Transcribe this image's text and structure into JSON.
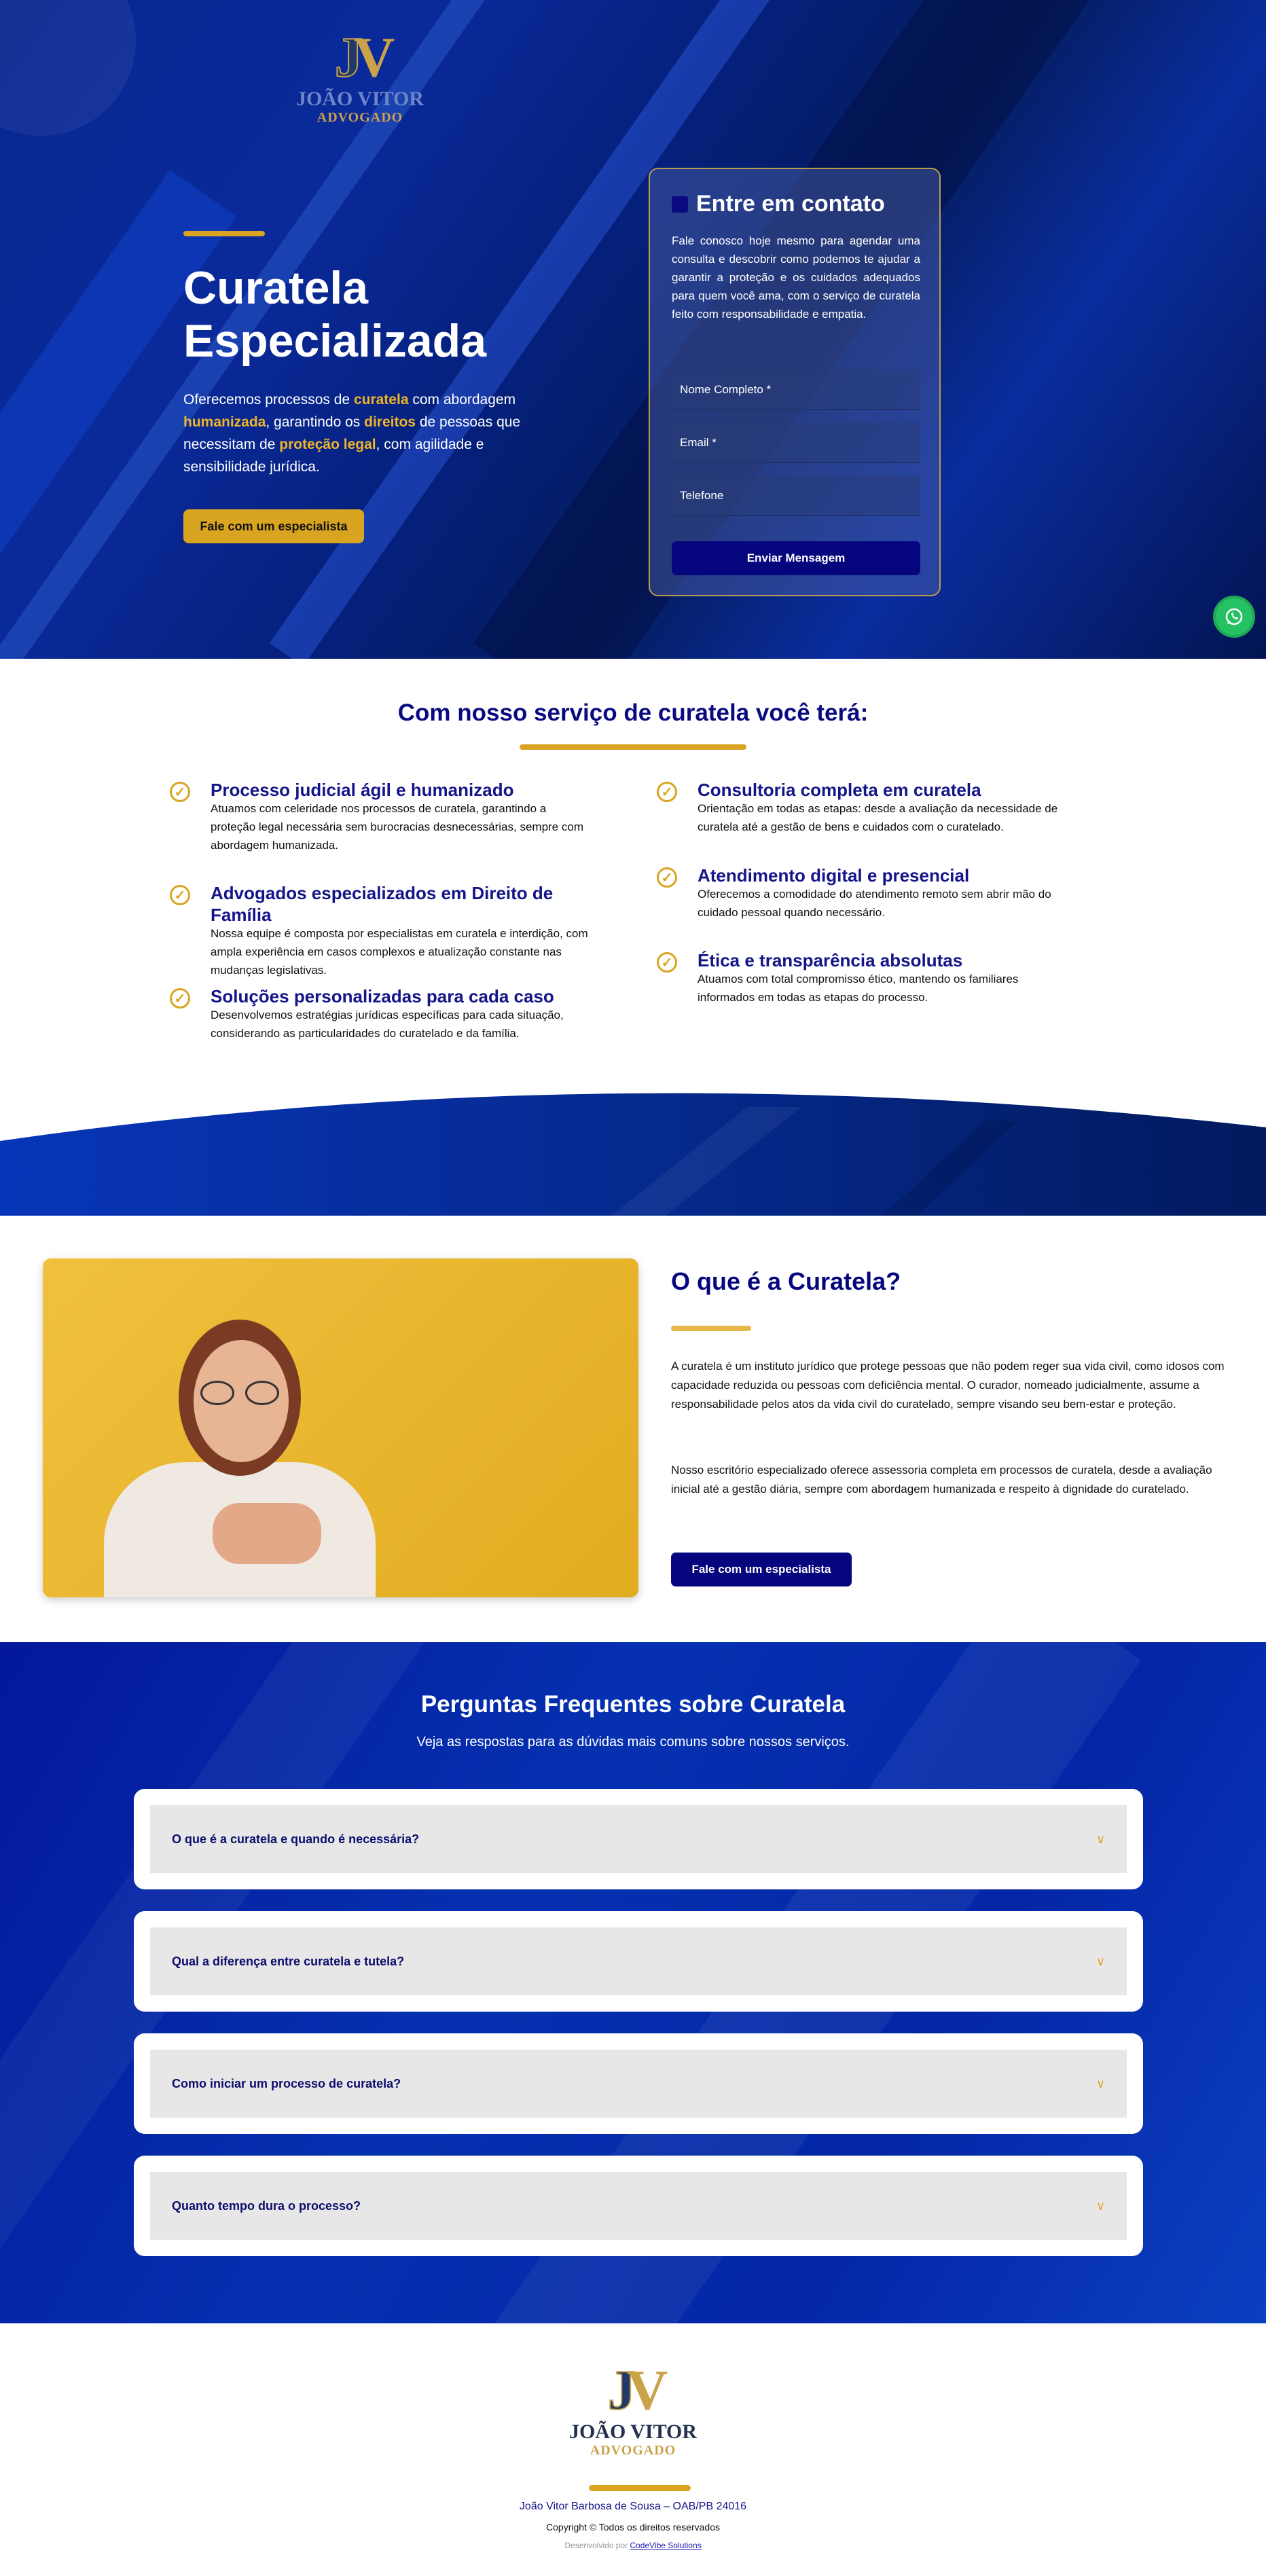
{
  "brand": {
    "logo_monogram": "JV",
    "logo_name": "JOÃO VITOR",
    "logo_sub": "ADVOGADO"
  },
  "hero": {
    "title_line1": "Curatela",
    "title_line2": "Especializada",
    "paragraph": [
      {
        "t": "Oferecemos processos de ",
        "h": false
      },
      {
        "t": "curatela",
        "h": true
      },
      {
        "t": " com abordagem ",
        "h": false
      },
      {
        "t": "humanizada",
        "h": true
      },
      {
        "t": ", garantindo os ",
        "h": false
      },
      {
        "t": "direitos",
        "h": true
      },
      {
        "t": " de pessoas que necessitam de ",
        "h": false
      },
      {
        "t": "proteção legal",
        "h": true
      },
      {
        "t": ", com agilidade e sensibilidade jurídica.",
        "h": false
      }
    ],
    "cta": "Fale com um especialista"
  },
  "contact": {
    "title": "Entre em contato",
    "text": "Fale conosco hoje mesmo para agendar uma consulta e descobrir como podemos te ajudar a garantir a proteção e os cuidados adequados para quem você ama, com o serviço de curatela feito com responsabilidade e empatia.",
    "name_placeholder": "Nome Completo *",
    "email_placeholder": "Email *",
    "phone_placeholder": "Telefone",
    "submit": "Enviar Mensagem"
  },
  "benefits": {
    "title": "Com nosso serviço de curatela você terá:",
    "left": [
      {
        "title": "Processo judicial ágil e humanizado",
        "text": "Atuamos com celeridade nos processos de curatela, garantindo a proteção legal necessária sem burocracias desnecessárias, sempre com abordagem humanizada."
      },
      {
        "title": "Advogados especializados em Direito de Família",
        "text": "Nossa equipe é composta por especialistas em curatela e interdição, com ampla experiência em casos complexos e atualização constante nas mudanças legislativas."
      },
      {
        "title": "Soluções personalizadas para cada caso",
        "text": "Desenvolvemos estratégias jurídicas específicas para cada situação, considerando as particularidades do curatelado e da família."
      }
    ],
    "right": [
      {
        "title": "Consultoria completa em curatela",
        "text": "Orientação em todas as etapas: desde a avaliação da necessidade de curatela até a gestão de bens e cuidados com o curatelado."
      },
      {
        "title": "Atendimento digital e presencial",
        "text": "Oferecemos a comodidade do atendimento remoto sem abrir mão do cuidado pessoal quando necessário."
      },
      {
        "title": "Ética e transparência absolutas",
        "text": "Atuamos com total compromisso ético, mantendo os familiares informados em todas as etapas do processo."
      }
    ]
  },
  "about": {
    "title": "O que é a Curatela?",
    "p1": "A curatela é um instituto jurídico que protege pessoas que não podem reger sua vida civil, como idosos com capacidade reduzida ou pessoas com deficiência mental. O curador, nomeado judicialmente, assume a responsabilidade pelos atos da vida civil do curatelado, sempre visando seu bem-estar e proteção.",
    "p2": "Nosso escritório especializado oferece assessoria completa em processos de curatela, desde a avaliação inicial até a gestão diária, sempre com abordagem humanizada e respeito à dignidade do curatelado.",
    "cta": "Fale com um especialista"
  },
  "faq": {
    "title": "Perguntas Frequentes sobre Curatela",
    "subtitle": "Veja as respostas para as dúvidas mais comuns sobre nossos serviços.",
    "items": [
      "O que é a curatela e quando é necessária?",
      "Qual a diferença entre curatela e tutela?",
      "Como iniciar um processo de curatela?",
      "Quanto tempo dura o processo?"
    ]
  },
  "footer": {
    "name": "João Vitor Barbosa de Sousa – OAB/PB 24016",
    "copyright": "Copyright © Todos os direitos reservados",
    "dev_prefix": "Desenvolvido por ",
    "dev_link": "CodeVibe Solutions"
  },
  "colors": {
    "navy": "#05057e",
    "gold": "#d9a521",
    "whatsapp": "#25c264"
  },
  "icons": {
    "check": "check-circle-icon",
    "whatsapp": "whatsapp-icon",
    "chevron": "chevron-down-icon"
  }
}
